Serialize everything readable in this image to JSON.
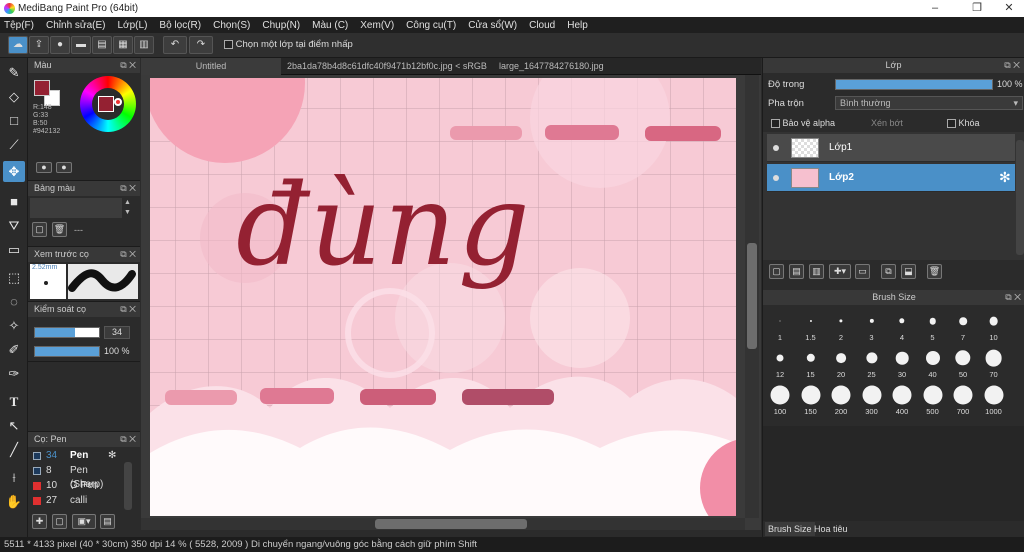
{
  "window": {
    "title": "MediBang Paint Pro (64bit)",
    "minimize": "–",
    "maximize": "❐",
    "close": "✕"
  },
  "menu": [
    "Tệp(F)",
    "Chỉnh sửa(E)",
    "Lớp(L)",
    "Bộ lọc(R)",
    "Chọn(S)",
    "Chụp(N)",
    "Màu (C)",
    "Xem(V)",
    "Công cụ(T)",
    "Cửa sổ(W)",
    "Cloud",
    "Help"
  ],
  "toolbar": {
    "select_label": "Chọn một lớp tại điểm nhấp"
  },
  "color_panel": {
    "title": "Màu",
    "r": "R:148",
    "g": "G:33",
    "b": "B:50",
    "hex": "#942132",
    "primary": "#942132",
    "secondary": "#ffffff"
  },
  "palette_panel": {
    "title": "Bảng màu",
    "value": "---"
  },
  "preview_panel": {
    "title": "Xem trước cọ",
    "size": "2.52mm"
  },
  "brush_control": {
    "title": "Kiểm soát cọ",
    "size": "34",
    "size_fraction": 0.62,
    "opacity": "100 %",
    "opacity_fraction": 1.0
  },
  "brush_panel": {
    "title": "Cọ: Pen",
    "brushes": [
      {
        "size": "34",
        "name": "Pen",
        "color": "#1d3a5c",
        "selected": true
      },
      {
        "size": "8",
        "name": "Pen (Sharp)",
        "color": "#1d3a5c",
        "selected": false
      },
      {
        "size": "10",
        "name": "G Pen",
        "color": "#e03030",
        "selected": false
      },
      {
        "size": "27",
        "name": "calli",
        "color": "#e03030",
        "selected": false
      }
    ]
  },
  "tabs": [
    "Untitled",
    "2ba1da78b4d8c61dfc40f9471b12bf0c.jpg < sRGB >",
    "large_1647784276180.jpg"
  ],
  "canvas": {
    "text": "đùng",
    "ink": "#942132"
  },
  "layer_panel": {
    "title": "Lớp",
    "opacity_label": "Độ trong",
    "opacity_value": "100 %",
    "opacity_fraction": 1.0,
    "blend_label": "Pha trộn",
    "blend_value": "Bình thường",
    "protect_alpha": "Bảo vệ alpha",
    "clipping": "Xén bớt",
    "lock": "Khóa",
    "layers": [
      {
        "name": "Lớp1",
        "selected": false
      },
      {
        "name": "Lớp2",
        "selected": true
      }
    ]
  },
  "brush_size_panel": {
    "title": "Brush Size",
    "sizes": [
      "1",
      "1.5",
      "2",
      "3",
      "4",
      "5",
      "7",
      "10",
      "12",
      "15",
      "20",
      "25",
      "30",
      "40",
      "50",
      "70",
      "100",
      "150",
      "200",
      "300",
      "400",
      "500",
      "700",
      "1000"
    ]
  },
  "bottom_tabs": [
    "Brush Size",
    "Hoa tiêu"
  ],
  "status": "5511 * 4133 pixel   (40 * 30cm)   350 dpi   14 %   ( 5528, 2009 )   Di chuyển ngang/vuông góc bằng cách giữ phím Shift"
}
